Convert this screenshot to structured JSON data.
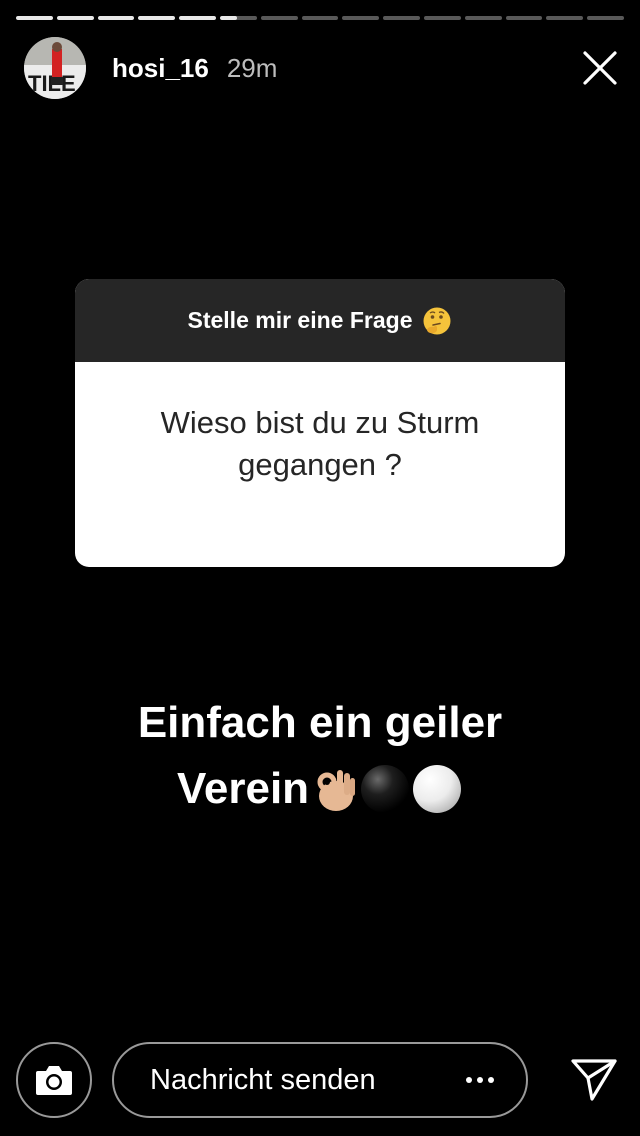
{
  "story": {
    "progress": {
      "segments": [
        1,
        1,
        1,
        1,
        1,
        0.45,
        0,
        0,
        0,
        0,
        0,
        0,
        0,
        0,
        0
      ]
    },
    "header": {
      "username": "hosi_16",
      "time": "29m"
    },
    "question_sticker": {
      "title": "Stelle mir eine Frage",
      "title_emoji": "thinking-face",
      "question": "Wieso bist du zu Sturm gegangen ?"
    },
    "answer": {
      "line1": "Einfach ein geiler",
      "line2": "Verein",
      "emojis": [
        "ok-hand-light",
        "black-circle",
        "white-circle"
      ]
    },
    "footer": {
      "message_placeholder": "Nachricht senden"
    }
  },
  "colors": {
    "background": "#000000",
    "card_header": "#262626",
    "card_body": "#ffffff",
    "text_dark": "#262626",
    "time_gray": "#bdbdbd"
  }
}
